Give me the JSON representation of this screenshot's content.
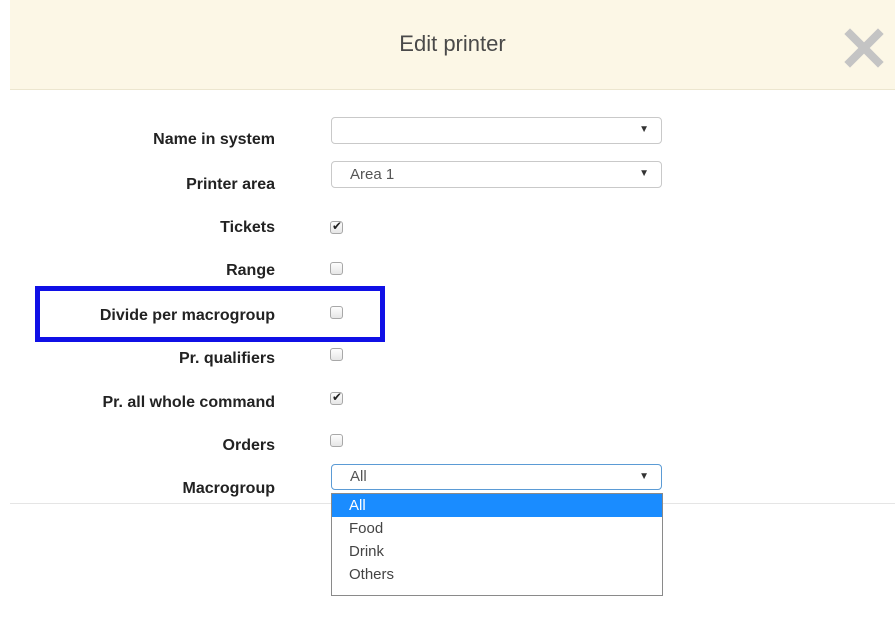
{
  "header": {
    "title": "Edit printer",
    "close_icon": "close-x-icon"
  },
  "form": {
    "name_in_system": {
      "label": "Name in system",
      "value": ""
    },
    "printer_area": {
      "label": "Printer area",
      "value": "Area 1"
    },
    "tickets": {
      "label": "Tickets",
      "checked": true
    },
    "range": {
      "label": "Range",
      "checked": false
    },
    "divide_per_macrogroup": {
      "label": "Divide per macrogroup",
      "checked": false
    },
    "pr_qualifiers": {
      "label": "Pr. qualifiers",
      "checked": false
    },
    "pr_all_whole_command": {
      "label": "Pr. all whole command",
      "checked": true
    },
    "orders": {
      "label": "Orders",
      "checked": false
    },
    "macrogroup": {
      "label": "Macrogroup",
      "value": "All",
      "options": [
        "All",
        "Food",
        "Drink",
        "Others"
      ],
      "selected_option": "All"
    }
  },
  "colors": {
    "header_bg": "#fcf7e6",
    "highlight_border": "#1010e6",
    "selected_option_bg": "#1a8cff"
  }
}
